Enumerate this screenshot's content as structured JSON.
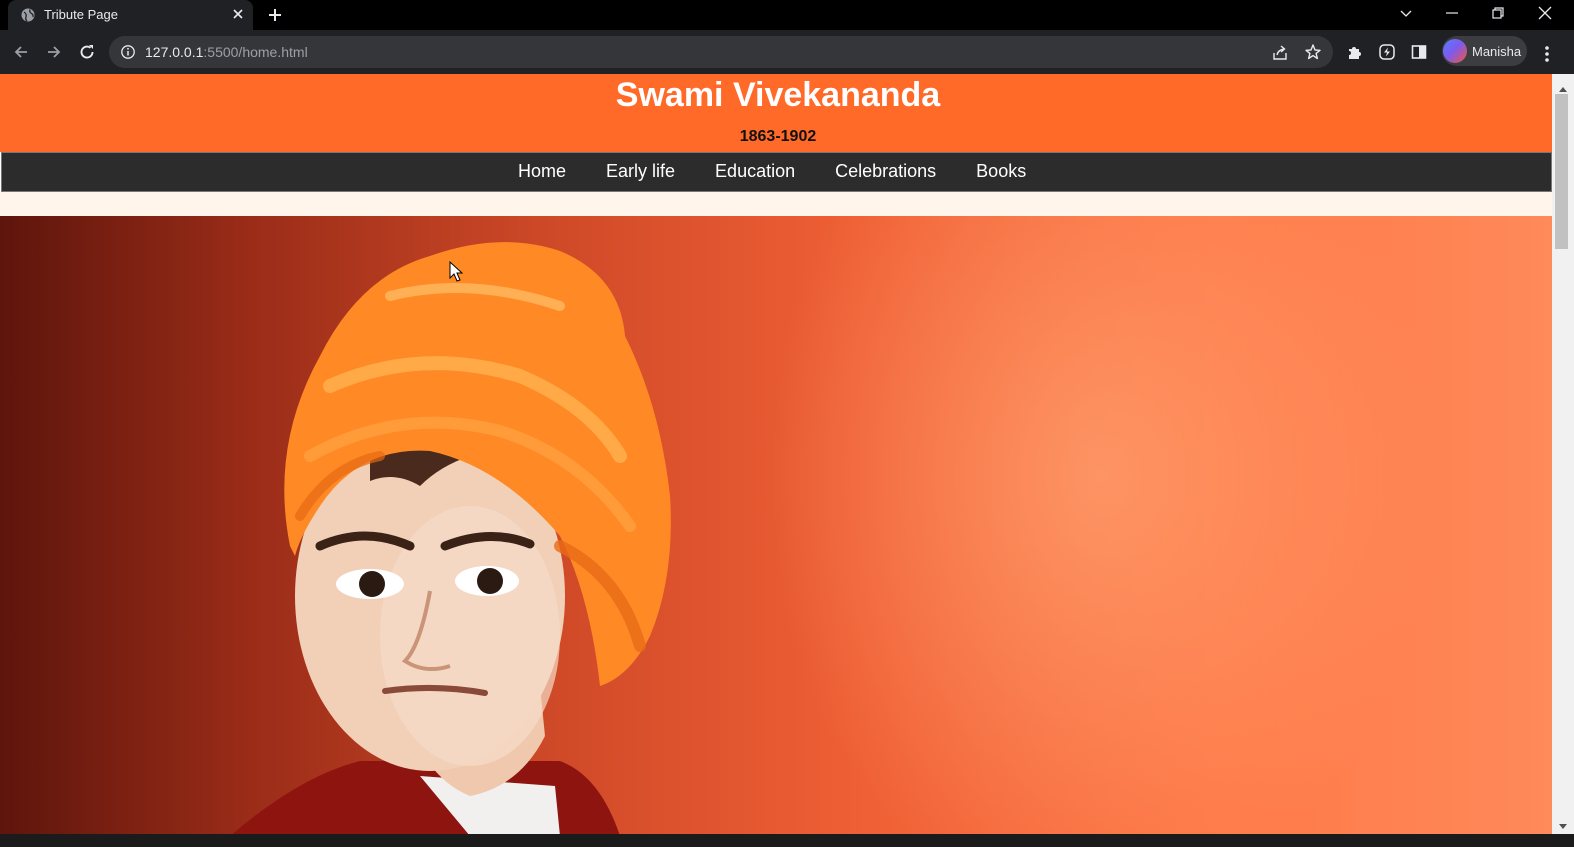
{
  "browser": {
    "tab_title": "Tribute Page",
    "url_host": "127.0.0.1",
    "url_path": ":5500/home.html",
    "profile_name": "Manisha"
  },
  "page": {
    "title": "Swami Vivekananda",
    "years": "1863-1902",
    "nav": [
      "Home",
      "Early life",
      "Education",
      "Celebrations",
      "Books"
    ]
  },
  "icons": {
    "tab_favicon": "globe-icon",
    "tab_close": "close-icon",
    "new_tab": "plus-icon",
    "back": "arrow-left-icon",
    "forward": "arrow-right-icon",
    "reload": "reload-icon",
    "site_info": "info-icon",
    "share": "share-icon",
    "bookmark": "star-icon",
    "extensions": "puzzle-icon",
    "extension_app": "lightning-icon",
    "side_panel": "side-panel-icon",
    "menu": "kebab-menu-icon"
  },
  "colors": {
    "header_bg": "#ff6a28",
    "nav_bg": "#2c2c2c",
    "chrome_bg": "#202124"
  }
}
